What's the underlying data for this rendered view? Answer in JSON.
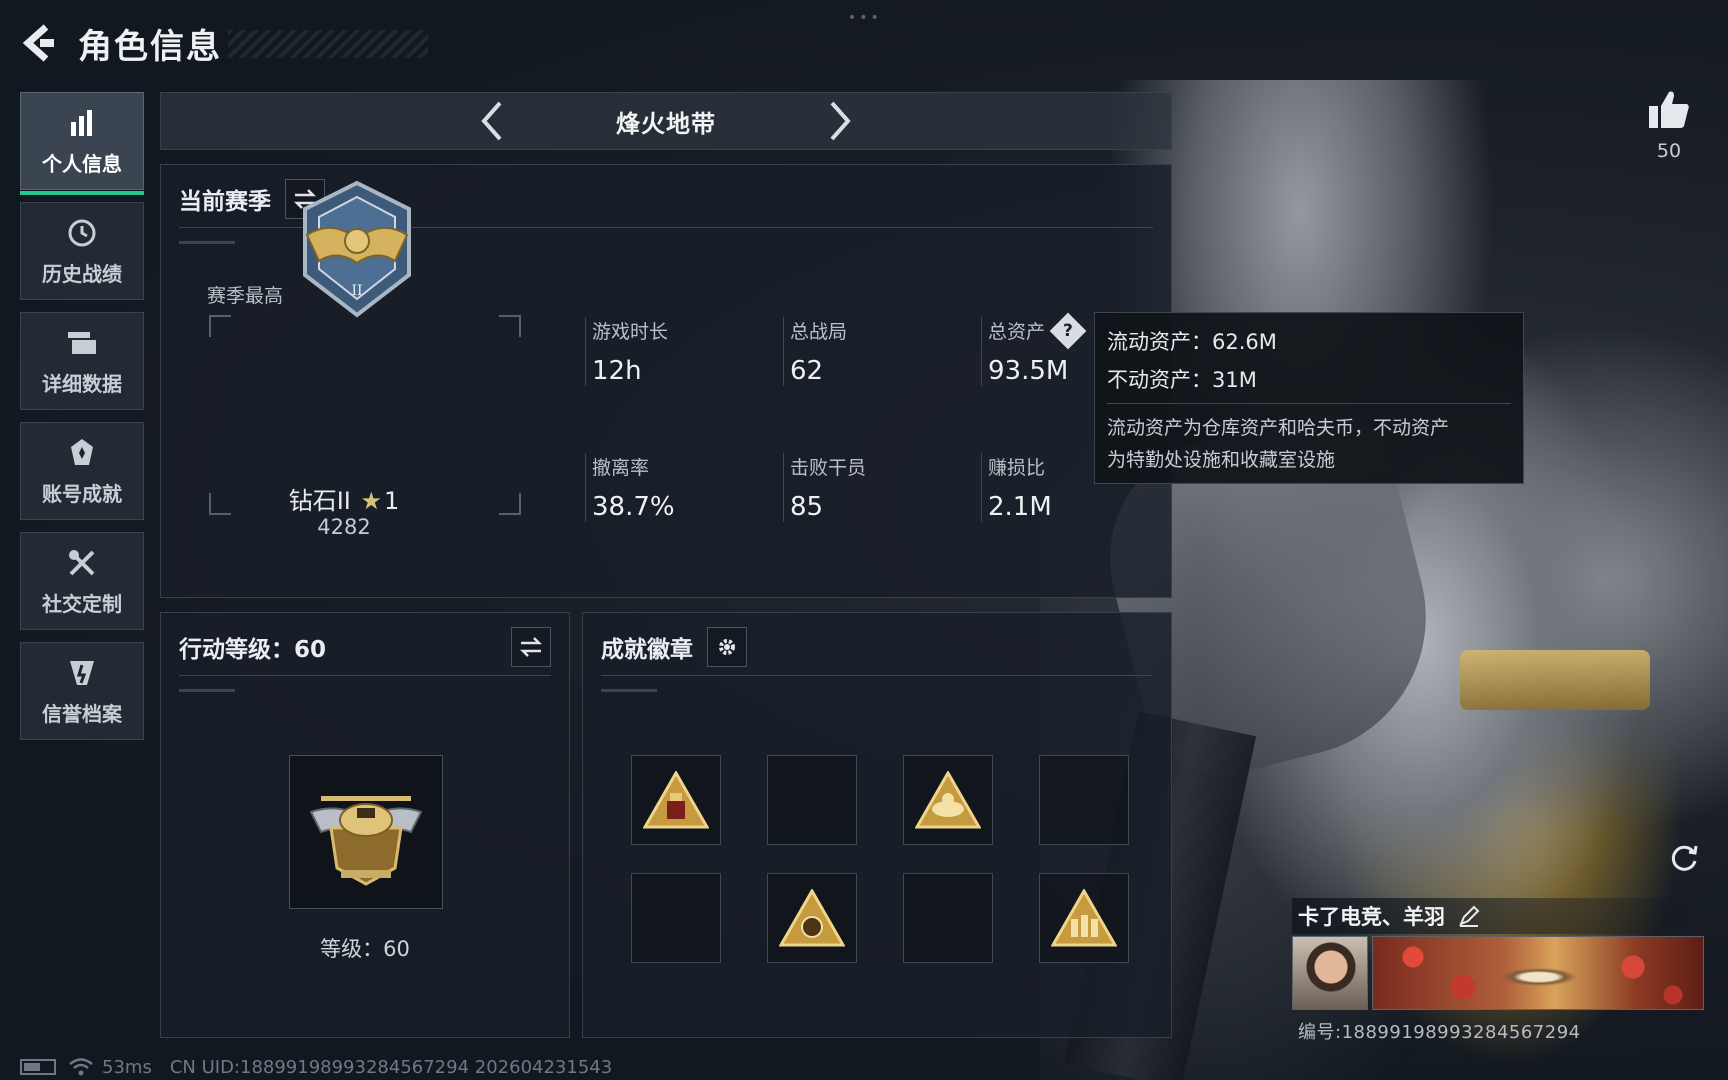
{
  "header": {
    "title": "角色信息"
  },
  "nav": {
    "items": [
      {
        "label": "个人信息",
        "icon": "bar-chart-icon",
        "active": true
      },
      {
        "label": "历史战绩",
        "icon": "history-clock-icon",
        "active": false
      },
      {
        "label": "详细数据",
        "icon": "folder-icon",
        "active": false
      },
      {
        "label": "账号成就",
        "icon": "achievement-medal-icon",
        "active": false
      },
      {
        "label": "社交定制",
        "icon": "tools-icon",
        "active": false
      },
      {
        "label": "信誉档案",
        "icon": "credit-shield-icon",
        "active": false
      }
    ]
  },
  "mode": {
    "title": "烽火地带"
  },
  "season": {
    "title": "当前赛季",
    "best_label": "赛季最高",
    "rank_name": "钻石II",
    "rank_stars": "1",
    "rank_score": "4282",
    "stats": [
      {
        "label": "游戏时长",
        "value": "12h"
      },
      {
        "label": "总战局",
        "value": "62"
      },
      {
        "label": "总资产",
        "value": "93.5M"
      },
      {
        "label": "撤离率",
        "value": "38.7%"
      },
      {
        "label": "击败干员",
        "value": "85"
      },
      {
        "label": "赚损比",
        "value": "2.1M"
      }
    ]
  },
  "tooltip": {
    "liquid": "流动资产：62.6M",
    "fixed": "不动资产：31M",
    "note_line1": "流动资产为仓库资产和哈夫币，不动资产",
    "note_line2": "为特勤处设施和收藏室设施"
  },
  "level": {
    "title": "行动等级：60",
    "level_text": "等级：60"
  },
  "badges": {
    "title": "成就徽章"
  },
  "like": {
    "count": "50"
  },
  "player": {
    "name": "卡了电竞、羊羽",
    "id": "编号:18899198993284567294"
  },
  "status": {
    "ping": "53ms",
    "uid": "CN UID:18899198993284567294  202604231543"
  },
  "colors": {
    "accent_green": "#27c98a",
    "gold": "#d8c17a"
  }
}
